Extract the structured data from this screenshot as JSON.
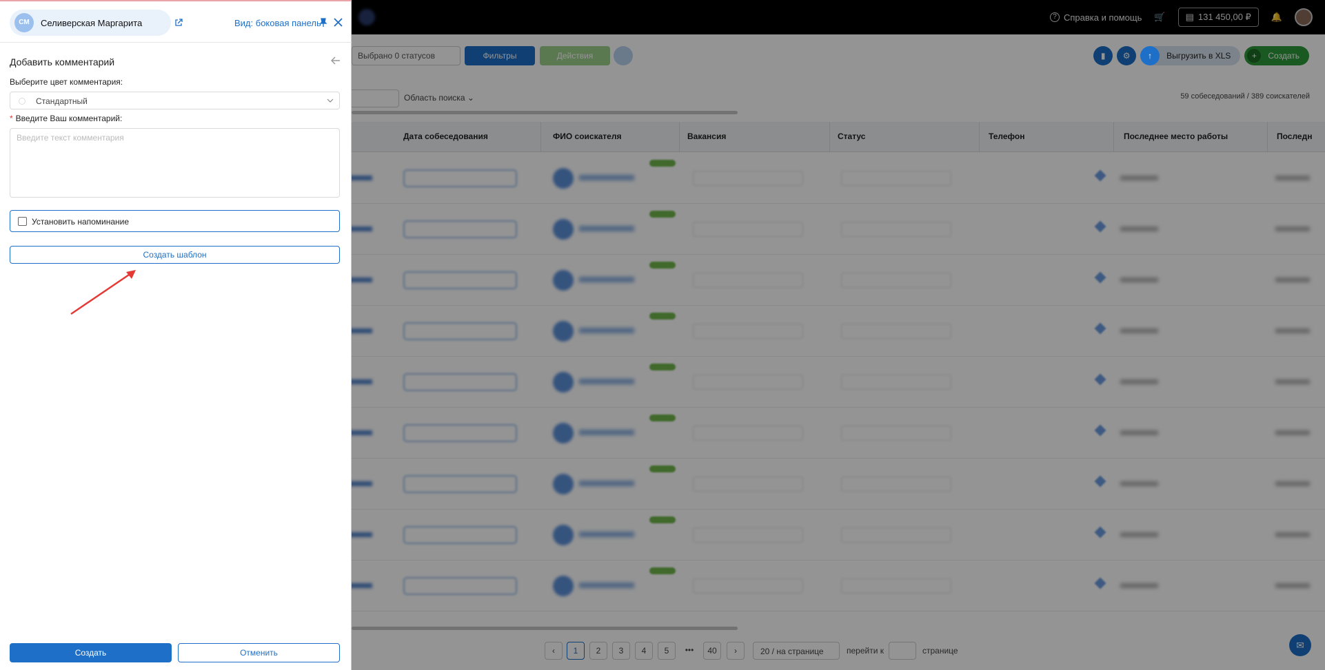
{
  "topbar": {
    "help_label": "Справка и помощь",
    "balance": "131 450,00 ₽"
  },
  "toolbar": {
    "status_select": "Выбрано 0 статусов",
    "filters_label": "Фильтры",
    "actions_label": "Действия",
    "export_label": "Выгрузить в XLS",
    "create_label": "Создать"
  },
  "search": {
    "scope_label": "Область поиска",
    "counts": "59 собеседований / 389 соискателей"
  },
  "table": {
    "columns": [
      "Дата собеседования",
      "ФИО соискателя",
      "Вакансия",
      "Статус",
      "Телефон",
      "Последнее место работы",
      "Последн"
    ]
  },
  "pagination": {
    "pages": [
      "1",
      "2",
      "3",
      "4",
      "5",
      "•••",
      "40"
    ],
    "per_page": "20 / на странице",
    "goto_label": "перейти к",
    "page_suffix": "странице"
  },
  "panel": {
    "user_initials": "СМ",
    "user_name": "Селиверская Маргарита",
    "view_label": "Вид: боковая панель",
    "title": "Добавить комментарий",
    "color_label": "Выберите цвет комментария:",
    "color_value": "Стандартный",
    "comment_label": "Введите Ваш комментарий:",
    "comment_placeholder": "Введите текст комментария",
    "reminder_label": "Установить напоминание",
    "template_button": "Создать шаблон",
    "create_button": "Создать",
    "cancel_button": "Отменить"
  },
  "colors": {
    "accent": "#1d6fc7",
    "annotation_arrow": "#e53935"
  }
}
